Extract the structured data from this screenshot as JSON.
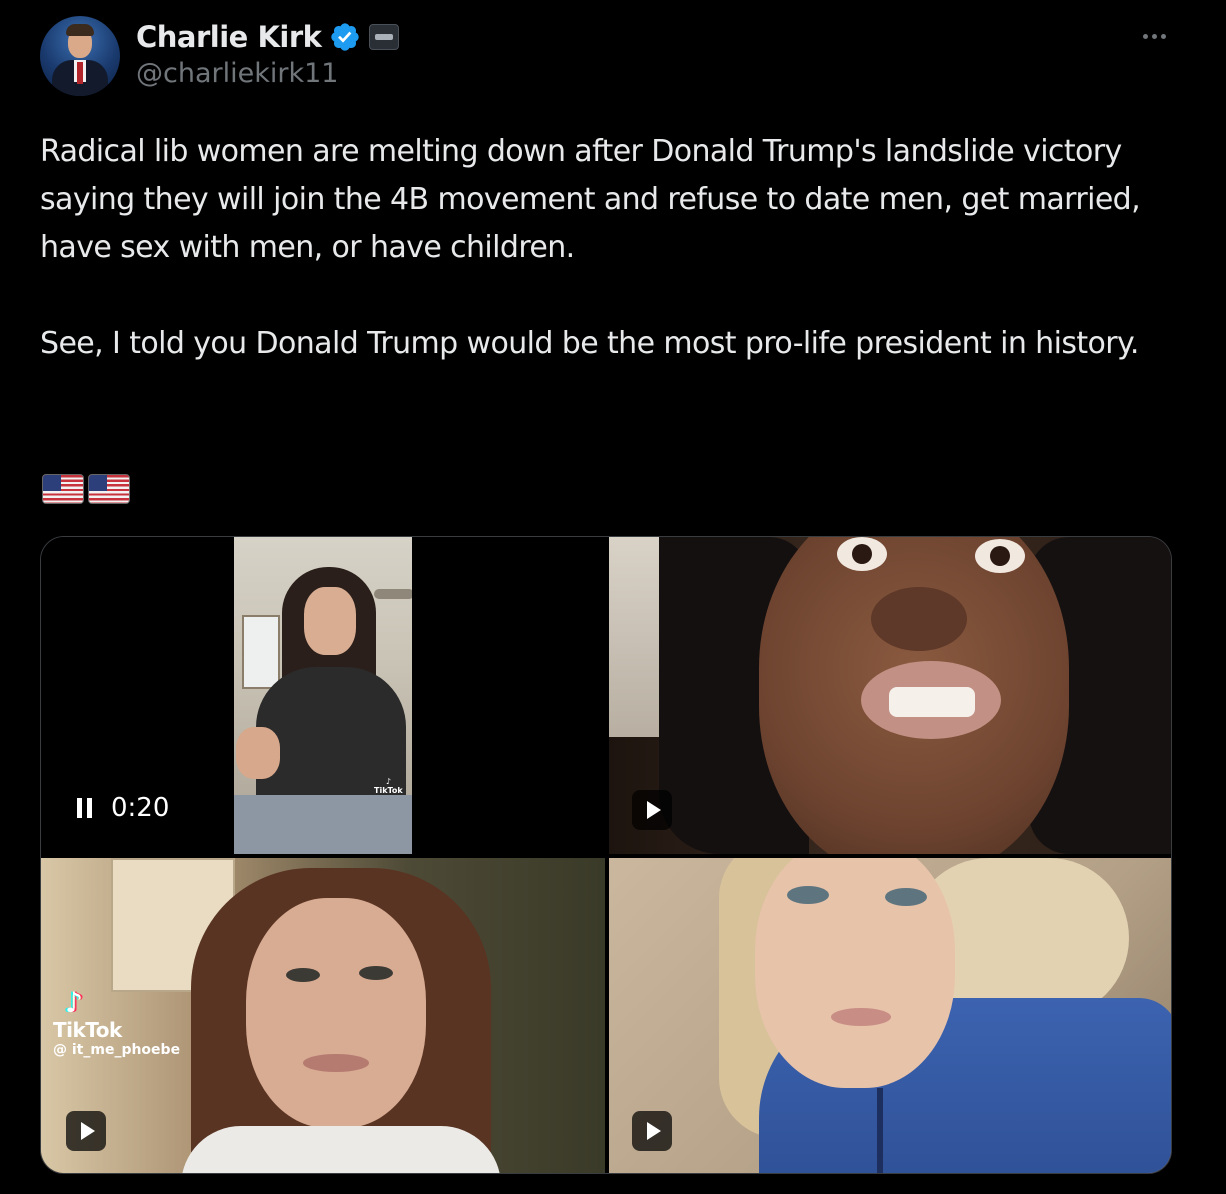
{
  "author": {
    "display_name": "Charlie Kirk",
    "handle": "@charliekirk11",
    "verified": true,
    "verified_color": "#1d9bf0",
    "avatar_icon": "profile-photo",
    "affiliation_icon": "organization-badge"
  },
  "tweet": {
    "paragraphs": [
      "Radical lib women are melting down after Donald Trump's landslide victory saying they will join the 4B movement and refuse to date men, get married, have sex with men, or have children.",
      "See, I told you Donald Trump would be the most pro-life president in history."
    ],
    "emoji": [
      "us-flag-emoji",
      "us-flag-emoji"
    ],
    "more_icon": "ellipsis-icon"
  },
  "media": {
    "tiles": [
      {
        "type": "video",
        "state": "playing",
        "time": "0:20",
        "control_icon": "pause-icon",
        "watermark": [
          "TikTok"
        ]
      },
      {
        "type": "video",
        "state": "paused",
        "control_icon": "play-icon"
      },
      {
        "type": "video",
        "state": "paused",
        "control_icon": "play-icon",
        "watermark": [
          "TikTok",
          "@ it_me_phoebe"
        ]
      },
      {
        "type": "video",
        "state": "paused",
        "control_icon": "play-icon"
      }
    ]
  },
  "colors": {
    "background": "#000000",
    "text_primary": "#e7e9ea",
    "text_secondary": "#71767b",
    "border": "#3a3d40"
  }
}
